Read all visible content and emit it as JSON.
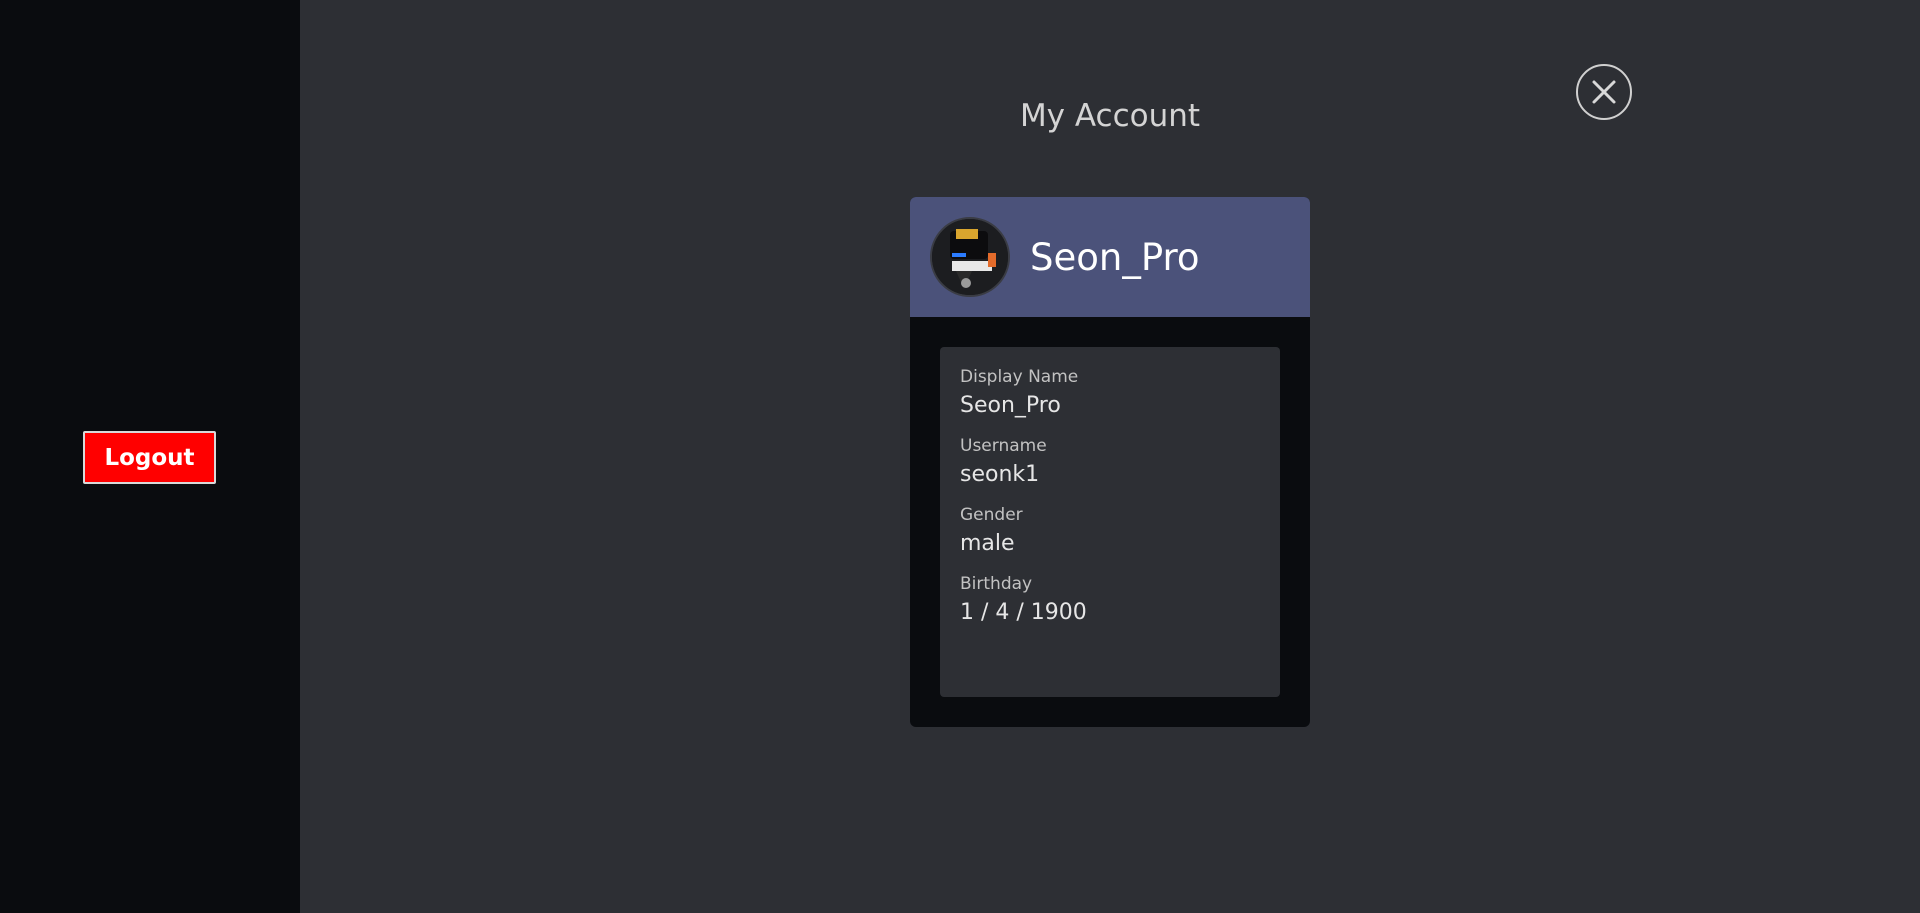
{
  "sidebar": {
    "logout_label": "Logout"
  },
  "header": {
    "title": "My Account",
    "close_icon": "close-icon"
  },
  "profile": {
    "username_display": "Seon_Pro",
    "avatar_icon": "avatar",
    "header_color": "#4b527a",
    "fields": [
      {
        "label": "Display Name",
        "value": "Seon_Pro"
      },
      {
        "label": "Username",
        "value": "seonk1"
      },
      {
        "label": "Gender",
        "value": "male"
      },
      {
        "label": "Birthday",
        "value": "1 / 4 / 1900"
      }
    ]
  },
  "colors": {
    "sidebar_bg": "#0a0c0f",
    "main_bg": "#2d2f34",
    "logout_bg": "#ff0000"
  }
}
